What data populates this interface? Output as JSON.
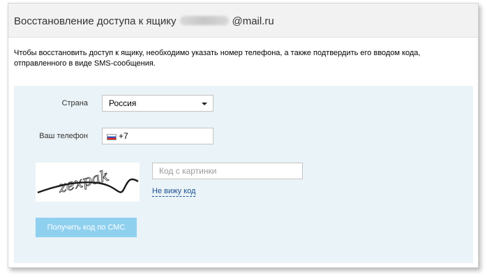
{
  "header": {
    "title_prefix": "Восстановление доступа к ящику",
    "email_domain": "@mail.ru"
  },
  "description": "Чтобы восстановить доступ к ящику, необходимо указать номер телефона, а также подтвердить его вводом кода, отправленного в виде SMS-сообщения.",
  "form": {
    "country_label": "Страна",
    "country_value": "Россия",
    "phone_label": "Ваш телефон",
    "phone_prefix": "+7",
    "captcha_text": "zexpak",
    "captcha_placeholder": "Код с картинки",
    "cant_see_link": "Не вижу код",
    "submit_label": "Получить код по СМС"
  },
  "colors": {
    "panel_background": "#eaf3f7",
    "button_disabled": "#8fd0ef",
    "link": "#1a4f95"
  },
  "icons": [
    "russia-flag-icon",
    "dropdown-caret-icon"
  ]
}
